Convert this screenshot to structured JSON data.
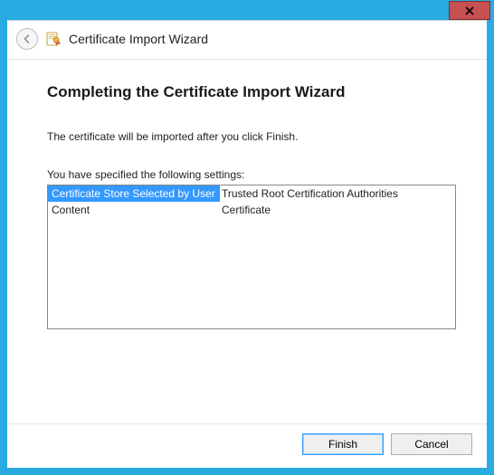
{
  "window": {
    "close_tooltip": "Close"
  },
  "header": {
    "title": "Certificate Import Wizard"
  },
  "page": {
    "heading": "Completing the Certificate Import Wizard",
    "description": "The certificate will be imported after you click Finish.",
    "settings_label": "You have specified the following settings:",
    "settings": [
      {
        "name": "Certificate Store Selected by User",
        "value": "Trusted Root Certification Authorities",
        "selected": true
      },
      {
        "name": "Content",
        "value": "Certificate",
        "selected": false
      }
    ]
  },
  "footer": {
    "finish": "Finish",
    "cancel": "Cancel"
  },
  "colors": {
    "frame": "#29abe2",
    "close": "#c75050",
    "selection": "#3399ff"
  }
}
